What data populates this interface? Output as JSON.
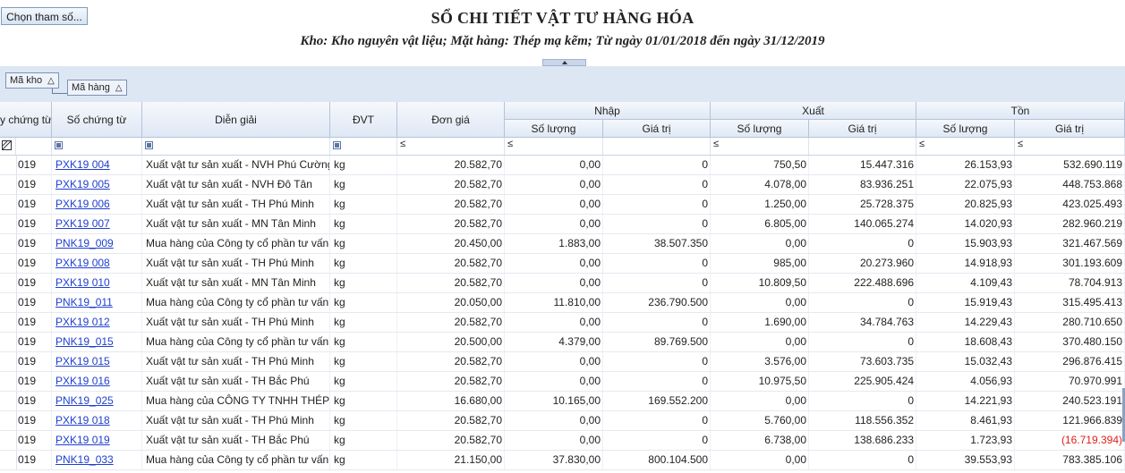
{
  "toolbar": {
    "choose_label": "Chọn tham số..."
  },
  "report": {
    "title": "SỔ CHI TIẾT VẬT TƯ HÀNG HÓA",
    "subtitle": "Kho: Kho nguyên vật liệu; Mặt hàng: Thép mạ kẽm; Từ ngày 01/01/2018 đến ngày 31/12/2019"
  },
  "group_panel": {
    "chip1": "Mã kho",
    "chip2": "Mã hàng",
    "sort_glyph": "△"
  },
  "columns": {
    "ngay": "y chứng từ",
    "so_ct": "Số chứng từ",
    "dien_giai": "Diễn giải",
    "dvt": "ĐVT",
    "don_gia": "Đơn giá",
    "nhap": "Nhập",
    "xuat": "Xuất",
    "ton": "Tồn",
    "so_luong": "Số lượng",
    "gia_tri": "Giá trị"
  },
  "filter": {
    "le": "≤",
    "filter_icon": "filter-editor-icon"
  },
  "rows": [
    {
      "d": "019",
      "ct": "PXK19 004",
      "dg": "Xuất vật tư sản xuất -  NVH Phú Cường",
      "dvt": "kg",
      "gia": "20.582,70",
      "nsl": "0,00",
      "ngt": "0",
      "xsl": "750,50",
      "xgt": "15.447.316",
      "tsl": "26.153,93",
      "tgt": "532.690.119",
      "neg": false
    },
    {
      "d": "019",
      "ct": "PXK19 005",
      "dg": "Xuất vật tư sản xuất - NVH Đô Tân",
      "dvt": "kg",
      "gia": "20.582,70",
      "nsl": "0,00",
      "ngt": "0",
      "xsl": "4.078,00",
      "xgt": "83.936.251",
      "tsl": "22.075,93",
      "tgt": "448.753.868",
      "neg": false
    },
    {
      "d": "019",
      "ct": "PXK19 006",
      "dg": "Xuất vật tư sản xuất - TH Phú Minh",
      "dvt": "kg",
      "gia": "20.582,70",
      "nsl": "0,00",
      "ngt": "0",
      "xsl": "1.250,00",
      "xgt": "25.728.375",
      "tsl": "20.825,93",
      "tgt": "423.025.493",
      "neg": false
    },
    {
      "d": "019",
      "ct": "PXK19 007",
      "dg": "Xuất vật tư sản xuất - MN Tân Minh",
      "dvt": "kg",
      "gia": "20.582,70",
      "nsl": "0,00",
      "ngt": "0",
      "xsl": "6.805,00",
      "xgt": "140.065.274",
      "tsl": "14.020,93",
      "tgt": "282.960.219",
      "neg": false
    },
    {
      "d": "019",
      "ct": "PNK19_009",
      "dg": "Mua hàng của Công ty cổ phần tư vấn đ",
      "dvt": "kg",
      "gia": "20.450,00",
      "nsl": "1.883,00",
      "ngt": "38.507.350",
      "xsl": "0,00",
      "xgt": "0",
      "tsl": "15.903,93",
      "tgt": "321.467.569",
      "neg": false
    },
    {
      "d": "019",
      "ct": "PXK19 008",
      "dg": "Xuất vật tư sản xuất - TH Phú Minh",
      "dvt": "kg",
      "gia": "20.582,70",
      "nsl": "0,00",
      "ngt": "0",
      "xsl": "985,00",
      "xgt": "20.273.960",
      "tsl": "14.918,93",
      "tgt": "301.193.609",
      "neg": false
    },
    {
      "d": "019",
      "ct": "PXK19 010",
      "dg": "Xuất vật tư sản xuất - MN Tân Minh",
      "dvt": "kg",
      "gia": "20.582,70",
      "nsl": "0,00",
      "ngt": "0",
      "xsl": "10.809,50",
      "xgt": "222.488.696",
      "tsl": "4.109,43",
      "tgt": "78.704.913",
      "neg": false
    },
    {
      "d": "019",
      "ct": "PNK19_011",
      "dg": "Mua hàng của Công ty cổ phần tư vấn đ",
      "dvt": "kg",
      "gia": "20.050,00",
      "nsl": "11.810,00",
      "ngt": "236.790.500",
      "xsl": "0,00",
      "xgt": "0",
      "tsl": "15.919,43",
      "tgt": "315.495.413",
      "neg": false
    },
    {
      "d": "019",
      "ct": "PXK19 012",
      "dg": "Xuất vật tư sản xuất - TH Phú Minh",
      "dvt": "kg",
      "gia": "20.582,70",
      "nsl": "0,00",
      "ngt": "0",
      "xsl": "1.690,00",
      "xgt": "34.784.763",
      "tsl": "14.229,43",
      "tgt": "280.710.650",
      "neg": false
    },
    {
      "d": "019",
      "ct": "PNK19_015",
      "dg": "Mua hàng của Công ty cổ phần tư vấn đ",
      "dvt": "kg",
      "gia": "20.500,00",
      "nsl": "4.379,00",
      "ngt": "89.769.500",
      "xsl": "0,00",
      "xgt": "0",
      "tsl": "18.608,43",
      "tgt": "370.480.150",
      "neg": false
    },
    {
      "d": "019",
      "ct": "PXK19 015",
      "dg": "Xuất vật tư sản xuất - TH Phú Minh",
      "dvt": "kg",
      "gia": "20.582,70",
      "nsl": "0,00",
      "ngt": "0",
      "xsl": "3.576,00",
      "xgt": "73.603.735",
      "tsl": "15.032,43",
      "tgt": "296.876.415",
      "neg": false
    },
    {
      "d": "019",
      "ct": "PXK19 016",
      "dg": "Xuất vật tư sản xuất - TH Bắc Phú",
      "dvt": "kg",
      "gia": "20.582,70",
      "nsl": "0,00",
      "ngt": "0",
      "xsl": "10.975,50",
      "xgt": "225.905.424",
      "tsl": "4.056,93",
      "tgt": "70.970.991",
      "neg": false
    },
    {
      "d": "019",
      "ct": "PNK19_025",
      "dg": "Mua hàng của CÔNG TY TNHH THÉP",
      "dvt": "kg",
      "gia": "16.680,00",
      "nsl": "10.165,00",
      "ngt": "169.552.200",
      "xsl": "0,00",
      "xgt": "0",
      "tsl": "14.221,93",
      "tgt": "240.523.191",
      "neg": false
    },
    {
      "d": "019",
      "ct": "PXK19 018",
      "dg": "Xuất vật tư sản xuất - TH Phú Minh",
      "dvt": "kg",
      "gia": "20.582,70",
      "nsl": "0,00",
      "ngt": "0",
      "xsl": "5.760,00",
      "xgt": "118.556.352",
      "tsl": "8.461,93",
      "tgt": "121.966.839",
      "neg": false
    },
    {
      "d": "019",
      "ct": "PXK19 019",
      "dg": "Xuất vật tư sản xuất - TH Bắc Phú",
      "dvt": "kg",
      "gia": "20.582,70",
      "nsl": "0,00",
      "ngt": "0",
      "xsl": "6.738,00",
      "xgt": "138.686.233",
      "tsl": "1.723,93",
      "tgt": "(16.719.394)",
      "neg": true
    },
    {
      "d": "019",
      "ct": "PNK19_033",
      "dg": "Mua hàng của Công ty cổ phần tư vấn đ",
      "dvt": "kg",
      "gia": "21.150,00",
      "nsl": "37.830,00",
      "ngt": "800.104.500",
      "xsl": "0,00",
      "xgt": "0",
      "tsl": "39.553,93",
      "tgt": "783.385.106",
      "neg": false
    }
  ]
}
